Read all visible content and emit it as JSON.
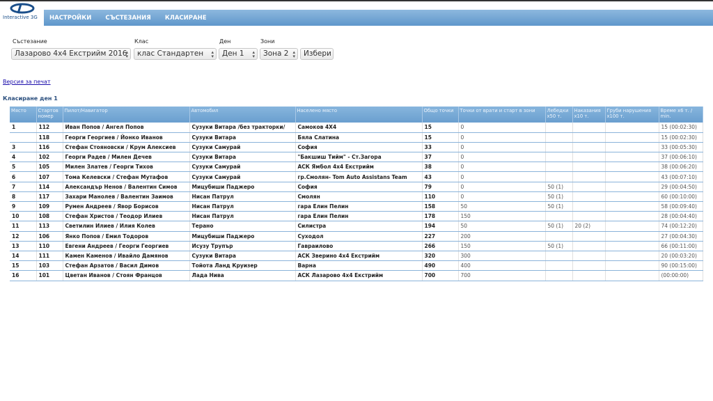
{
  "logo": {
    "text": "Interactive 3G"
  },
  "nav": [
    "НАСТРОЙКИ",
    "СЪСТЕЗАНИЯ",
    "КЛАСИРАНЕ"
  ],
  "filters": {
    "competition": {
      "label": "Състезание",
      "value": "Лазарово 4x4 Екстрийм 2016"
    },
    "class": {
      "label": "Клас",
      "value": "клас Стандартен"
    },
    "day": {
      "label": "Ден",
      "value": "Ден 1"
    },
    "zones": {
      "label": "Зони",
      "value": "Зона 2"
    },
    "submit": "Избери"
  },
  "print_link": "Версия за печат",
  "heading": "Класиране ден 1",
  "table": {
    "headers": [
      "Място",
      "Стартов номер",
      "Пилот/Навигатор",
      "Автомобил",
      "Населено място",
      "Общо точки",
      "Точки от врати и старт в зони",
      "Лебедки x50 т.",
      "Наказания x10 т.",
      "Груби нарушения x100 т.",
      "Време x6 т. / min."
    ],
    "rows": [
      [
        "1",
        "112",
        "Иван Попов / Ангел Попов",
        "Сузуки Витара /без тракторки/",
        "Самоков 4X4",
        "15",
        "0",
        "",
        "",
        "",
        "15 (00:02:30)"
      ],
      [
        "",
        "118",
        "Георги Георгиев / Йонко Иванов",
        "Сузуки Витара",
        "Бяла Слатина",
        "15",
        "0",
        "",
        "",
        "",
        "15 (00:02:30)"
      ],
      [
        "3",
        "116",
        "Стефан Стояновски / Крум Алексиев",
        "Сузуки Самурай",
        "София",
        "33",
        "0",
        "",
        "",
        "",
        "33 (00:05:30)"
      ],
      [
        "4",
        "102",
        "Георги Радев / Милен Дечев",
        "Сузуки Витара",
        "\"Бакшиш Тийм\" - Ст.Загора",
        "37",
        "0",
        "",
        "",
        "",
        "37 (00:06:10)"
      ],
      [
        "5",
        "105",
        "Милен Златев / Георги Тихов",
        "Сузуки Самурай",
        "АСК Ямбол 4x4 Екстрийм",
        "38",
        "0",
        "",
        "",
        "",
        "38 (00:06:20)"
      ],
      [
        "6",
        "107",
        "Тома Келевски / Стефан Мутафов",
        "Сузуки Самурай",
        "гр.Смолян- Tom Auto Assistans Team",
        "43",
        "0",
        "",
        "",
        "",
        "43 (00:07:10)"
      ],
      [
        "7",
        "114",
        "Александър Ненов / Валентин Симов",
        "Мицубиши Паджеро",
        "София",
        "79",
        "0",
        "50 (1)",
        "",
        "",
        "29 (00:04:50)"
      ],
      [
        "8",
        "117",
        "Захари Манолев / Валентин Заимов",
        "Нисан Патрул",
        "Смолян",
        "110",
        "0",
        "50 (1)",
        "",
        "",
        "60 (00:10:00)"
      ],
      [
        "9",
        "109",
        "Румен Андреев / Явор Борисов",
        "Нисан Патрул",
        "гара Елин Пелин",
        "158",
        "50",
        "50 (1)",
        "",
        "",
        "58 (00:09:40)"
      ],
      [
        "10",
        "108",
        "Стефан Христов / Теодор Илиев",
        "Нисан Патрул",
        "гара Елин Пелин",
        "178",
        "150",
        "",
        "",
        "",
        "28 (00:04:40)"
      ],
      [
        "11",
        "113",
        "Светилин Илиев / Илия Колев",
        "Терано",
        "Силистра",
        "194",
        "50",
        "50 (1)",
        "20 (2)",
        "",
        "74 (00:12:20)"
      ],
      [
        "12",
        "106",
        "Янко Попов / Емил Тодоров",
        "Мицубиши Паджеро",
        "Суходол",
        "227",
        "200",
        "",
        "",
        "",
        "27 (00:04:30)"
      ],
      [
        "13",
        "110",
        "Евгени Андреев / Георги Георгиев",
        "Исузу Трупър",
        "Гавраилово",
        "266",
        "150",
        "50 (1)",
        "",
        "",
        "66 (00:11:00)"
      ],
      [
        "14",
        "111",
        "Камен Каменов / Ивайло Дамянов",
        "Сузуки Витара",
        "АСК Зверино 4x4 Екстрийм",
        "320",
        "300",
        "",
        "",
        "",
        "20 (00:03:20)"
      ],
      [
        "15",
        "103",
        "Стефан Арзатов / Васил Димов",
        "Тойота Ланд Круизер",
        "Варна",
        "490",
        "400",
        "",
        "",
        "",
        "90 (00:15:00)"
      ],
      [
        "16",
        "101",
        "Цветан Иванов / Стоян Францов",
        "Лада Нива",
        "АСК Лазарово 4x4 Екстрийм",
        "700",
        "700",
        "",
        "",
        "",
        "(00:00:00)"
      ]
    ]
  }
}
